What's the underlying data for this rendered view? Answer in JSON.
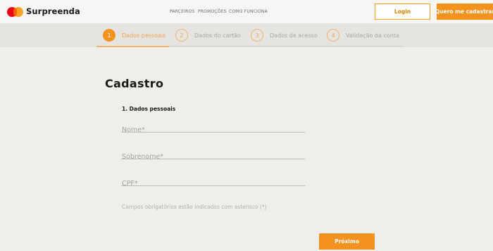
{
  "header": {
    "brand": "Surpreenda",
    "nav": [
      "PARCEIROS",
      "PROMOÇÕES",
      "COMO FUNCIONA"
    ],
    "login_label": "Login",
    "signup_label": "Quero me cadastrar"
  },
  "steps": [
    {
      "num": "1",
      "label": "Dados pessoais",
      "active": true
    },
    {
      "num": "2",
      "label": "Dados do cartão",
      "active": false
    },
    {
      "num": "3",
      "label": "Dados de acesso",
      "active": false
    },
    {
      "num": "4",
      "label": "Validação da conta",
      "active": false
    }
  ],
  "form": {
    "title": "Cadastro",
    "section": "1. Dados pessoais",
    "fields": {
      "nome": {
        "placeholder": "Nome*",
        "value": ""
      },
      "sobrenome": {
        "placeholder": "Sobrenome*",
        "value": ""
      },
      "cpf": {
        "placeholder": "CPF*",
        "value": ""
      }
    },
    "note": "Campos obrigatórios estão indicados com asterisco (*)",
    "next_label": "Próximo"
  },
  "colors": {
    "accent": "#f3921e",
    "accent_light": "#f3b36a",
    "background": "#f0eeeb",
    "steps_bar": "#e6e4e1"
  }
}
